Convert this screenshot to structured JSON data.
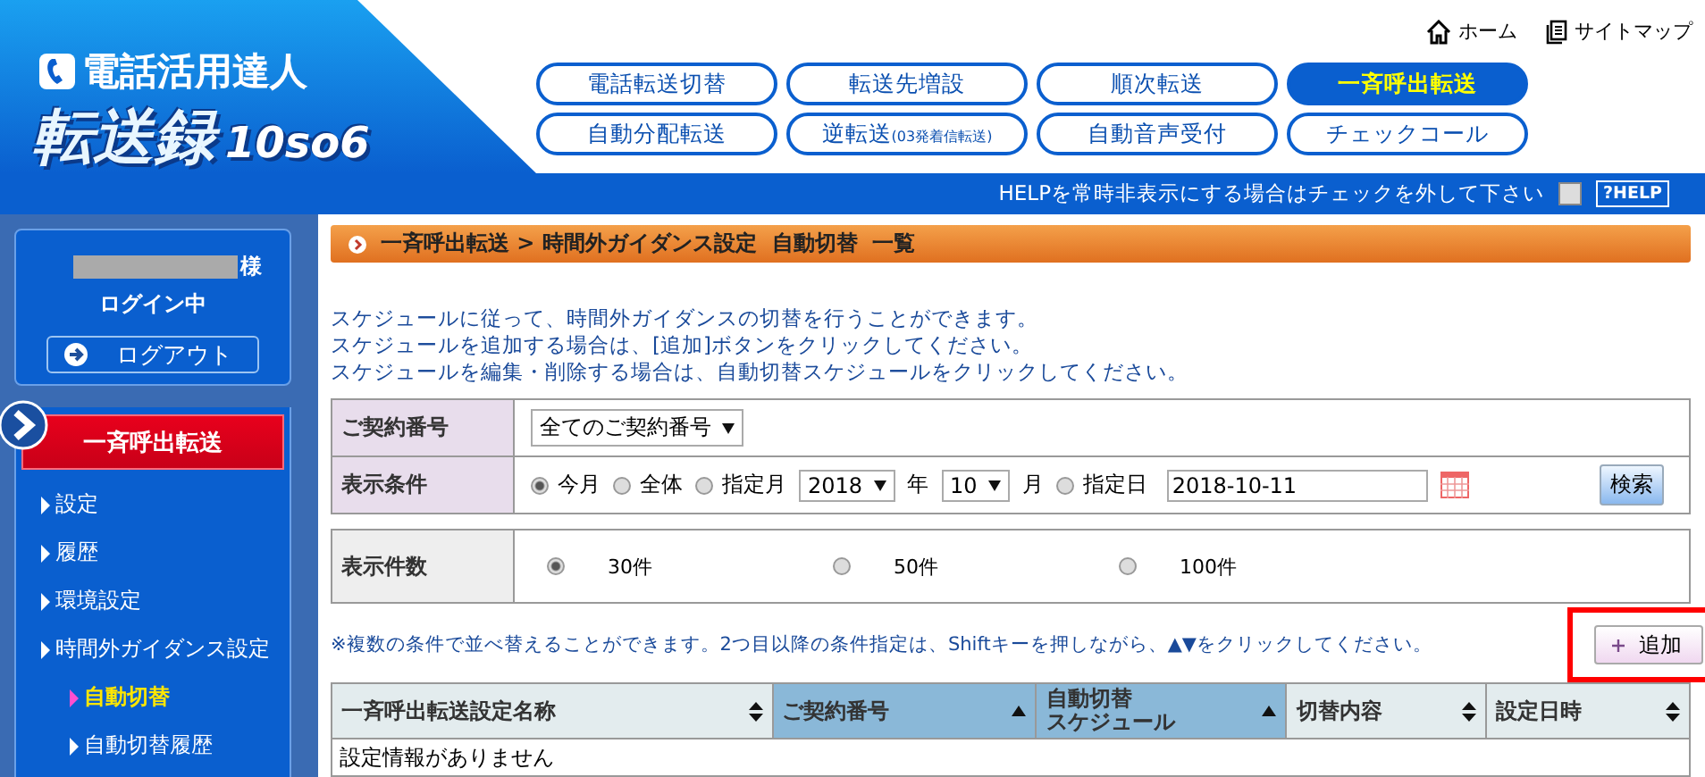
{
  "logo": {
    "subtitle": "電話活用達人",
    "title": "転送録",
    "version": "10so6"
  },
  "top_links": [
    {
      "kind": "home",
      "label": "ホーム"
    },
    {
      "kind": "sitemap",
      "label": "サイトマップ"
    }
  ],
  "nav_tabs": [
    {
      "label": "電話転送切替",
      "selected": false
    },
    {
      "label": "転送先増設",
      "selected": false
    },
    {
      "label": "順次転送",
      "selected": false
    },
    {
      "label": "一斉呼出転送",
      "selected": true
    },
    {
      "label": "自動分配転送",
      "selected": false
    },
    {
      "label": "逆転送",
      "note": "(03発着信転送)",
      "selected": false
    },
    {
      "label": "自動音声受付",
      "selected": false
    },
    {
      "label": "チェックコール",
      "selected": false
    }
  ],
  "help_bar": {
    "text": "HELPを常時非表示にする場合はチェックを外して下さい",
    "checked": false,
    "button": "?HELP"
  },
  "user": {
    "suffix": "様",
    "status": "ログイン中",
    "logout": "ログアウト"
  },
  "sidebar": {
    "section": {
      "label": "一斉呼出転送",
      "selected": true
    },
    "items": [
      {
        "label": "設定",
        "selected": false
      },
      {
        "label": "履歴",
        "selected": false
      },
      {
        "label": "環境設定",
        "selected": false
      },
      {
        "label": "時間外ガイダンス設定",
        "selected": false,
        "children": [
          {
            "label": "自動切替",
            "selected": true
          },
          {
            "label": "自動切替履歴",
            "selected": false
          }
        ]
      }
    ]
  },
  "breadcrumb": "一斉呼出転送 > 時間外ガイダンス設定  自動切替  一覧",
  "instructions": [
    "スケジュールに従って、時間外ガイダンスの切替を行うことができます。",
    "スケジュールを追加する場合は、[追加]ボタンをクリックしてください。",
    "スケジュールを編集・削除する場合は、自動切替スケジュールをクリックしてください。"
  ],
  "filters": {
    "contract": {
      "label": "ご契約番号",
      "value": "全てのご契約番号"
    },
    "condition": {
      "label": "表示条件",
      "options": [
        {
          "label": "今月",
          "selected": true
        },
        {
          "label": "全体",
          "selected": false
        },
        {
          "label": "指定月",
          "selected": false
        },
        {
          "label": "指定日",
          "selected": false
        }
      ],
      "year": "2018",
      "year_unit": "年",
      "month": "10",
      "month_unit": "月",
      "date": "2018-10-11",
      "search_button": "検索"
    }
  },
  "page_size": {
    "label": "表示件数",
    "options": [
      {
        "label": "30件",
        "selected": true
      },
      {
        "label": "50件",
        "selected": false
      },
      {
        "label": "100件",
        "selected": false
      }
    ]
  },
  "sort_note": "※複数の条件で並べ替えることができます。2つ目以降の条件指定は、Shiftキーを押しながら、▲▼をクリックしてください。",
  "add_button": {
    "label": "追加",
    "highlighted": true
  },
  "table": {
    "columns": [
      {
        "label_lines": [
          "一斉呼出転送設定名称"
        ],
        "sorted": false
      },
      {
        "label_lines": [
          "ご契約番号"
        ],
        "sorted": true
      },
      {
        "label_lines": [
          "自動切替",
          "スケジュール"
        ],
        "sorted": true
      },
      {
        "label_lines": [
          "切替内容"
        ],
        "sorted": false
      },
      {
        "label_lines": [
          "設定日時"
        ],
        "sorted": false
      }
    ],
    "empty_message": "設定情報がありません"
  }
}
